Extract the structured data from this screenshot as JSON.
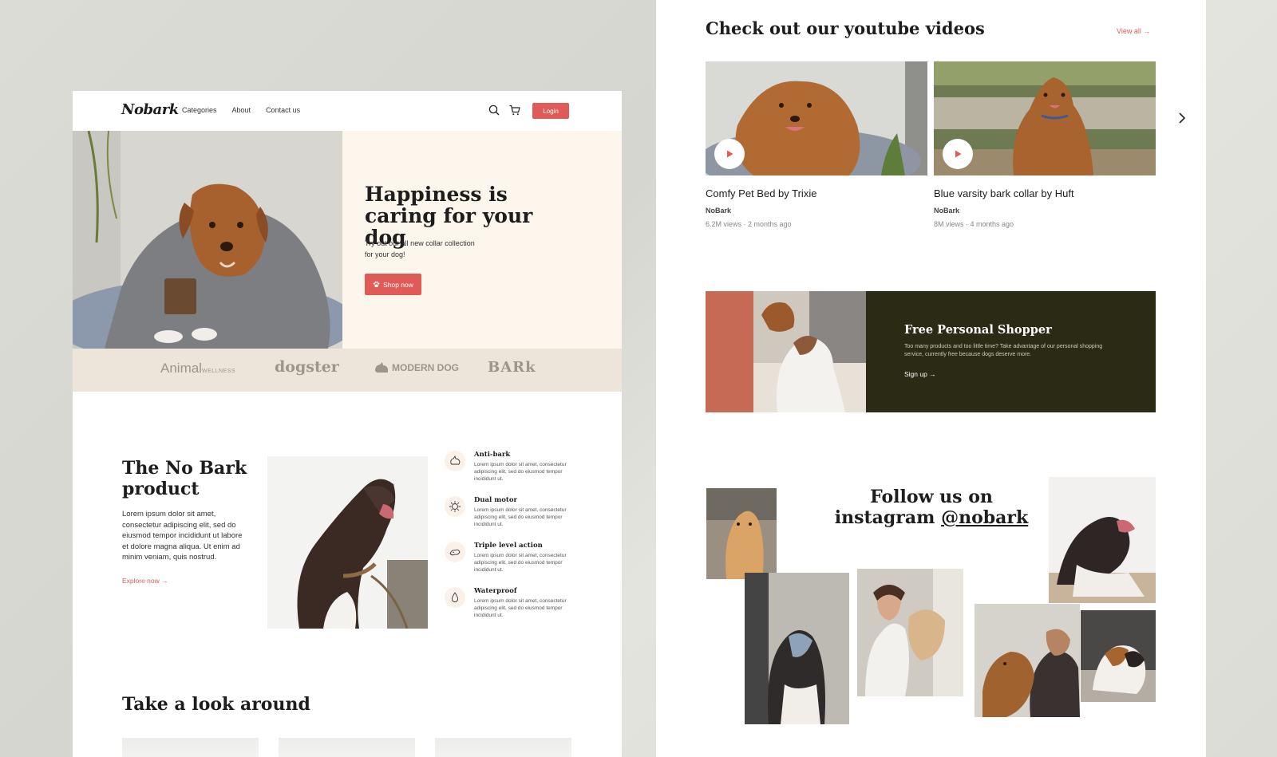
{
  "left": {
    "nav": {
      "logo": "Nobark",
      "links": [
        "Categories",
        "About",
        "Contact us"
      ],
      "login": "Login"
    },
    "hero": {
      "title": "Happiness is caring for your dog",
      "subtitle": "Try out our all new collar collection for your dog!",
      "cta": "Shop now"
    },
    "brands": [
      "Animal",
      "WELLNESS",
      "dogster",
      "MODERN DOG",
      "BARk"
    ],
    "feature": {
      "title": "The No Bark product",
      "description": "Lorem ipsum dolor sit amet, consectetur adipiscing elit, sed do eiusmod tempor incididunt ut labore et dolore magna aliqua. Ut enim ad minim veniam, quis nostrud.",
      "link": "Explore now",
      "items": [
        {
          "name": "Anti-bark",
          "desc": "Lorem ipsum dolor sit amet, consectetur adipiscing elit, sed do eiusmod tempor incididunt ut.",
          "icon": "dog-icon"
        },
        {
          "name": "Dual motor",
          "desc": "Lorem ipsum dolor sit amet, consectetur adipiscing elit, sed do eiusmod tempor incididunt ut.",
          "icon": "motor-icon"
        },
        {
          "name": "Triple level action",
          "desc": "Lorem ipsum dolor sit amet, consectetur adipiscing elit, sed do eiusmod tempor incididunt ut.",
          "icon": "action-icon"
        },
        {
          "name": "Waterproof",
          "desc": "Lorem ipsum dolor sit amet, consectetur adipiscing elit, sed do eiusmod tempor incididunt ut.",
          "icon": "water-drop-icon"
        }
      ]
    },
    "look_title": "Take a look around"
  },
  "right": {
    "youtube": {
      "title": "Check out our youtube videos",
      "view_all": "View all",
      "videos": [
        {
          "name": "Comfy Pet Bed by Trixie",
          "channel": "NoBark",
          "views": "6.2M views",
          "age": "2 months ago"
        },
        {
          "name": "Blue varsity bark collar by Huft",
          "channel": "NoBark",
          "views": "8M views",
          "age": "4 months ago"
        }
      ]
    },
    "shopper": {
      "title": "Free Personal Shopper",
      "description": "Too many products and too little time? Take advantage of our personal shopping service, currently free because dogs deserve more.",
      "cta": "Sign up"
    },
    "instagram": {
      "title_prefix": "Follow us on instagram",
      "handle": "@nobark"
    }
  },
  "colors": {
    "accent": "#e05a57",
    "hero_bg": "#fdf6ec",
    "brands_bg": "#ede5d9",
    "shopper_bg": "#2b2a14"
  }
}
